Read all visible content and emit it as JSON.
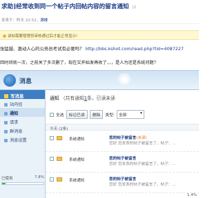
{
  "post": {
    "title": "求助]经常收到同一个帖子内回帖内容的留言通知",
    "views": "[2",
    "meta_prefix": "发表于：",
    "meta_time": "昨天 22:52",
    "meta_sep": "，",
    "author": "满楼",
    "notice": "该帖需要管理员审核通过后才能正常显示!",
    "line1_text": "张猛鼓、激动人心的公务员考试有必要吗？",
    "line1_url": "http://bbs.kshot.com/read.php?tid=4087227",
    "line2": "回时间就一次，之前关了多次删了，现在又开始发再收了，，，是人为还是系统问题？"
  },
  "app": {
    "title": "消息"
  },
  "sidebar": {
    "header": "写消息",
    "items": [
      {
        "label": "站内信"
      },
      {
        "label": "通知"
      },
      {
        "label": "请求"
      },
      {
        "label": "群消息"
      },
      {
        "label": "消息设置"
      }
    ]
  },
  "quota": {
    "label": "已使用",
    "value": "7.8%",
    "fraction": 0.078
  },
  "main": {
    "heading_prefix": "通知",
    "heading_sub": "（共有通知",
    "heading_count": "1",
    "heading_suffix": "条，已读未读",
    "toolbar": {
      "select_all": "全选",
      "mark_read": "标记已读",
      "delete": "删除",
      "type_label": "类型:",
      "type_value": "全部"
    },
    "group_today": "今天 (2条)",
    "messages": [
      {
        "sender": "系统通知",
        "subject": "您的帖子被留言",
        "tag": "(未读)",
        "preview": "您好 您发表的帖子被留言了，帖子：..."
      },
      {
        "sender": "系统通知",
        "subject": "您的帖子被留言",
        "tag": "",
        "preview": "您好 您发表的帖子被留言了，帖子：..."
      },
      {
        "sender": "系统通知",
        "subject": "您的帖子被留言",
        "tag": "",
        "preview": "您好 您发表的帖子被留言了，帖子：..."
      }
    ]
  },
  "status": {
    "zoom": "1.4%"
  }
}
